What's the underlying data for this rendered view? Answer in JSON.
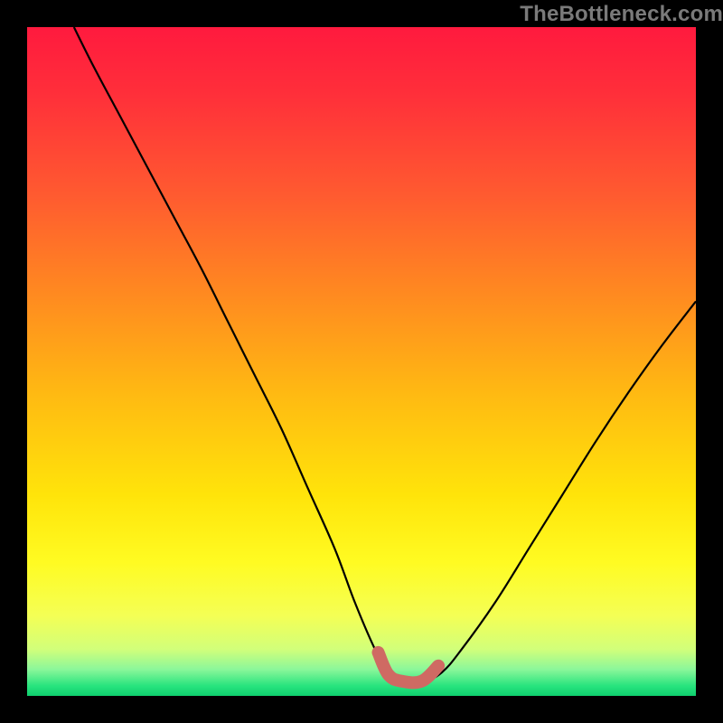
{
  "watermark": "TheBottleneck.com",
  "colors": {
    "frame_background": "#000000",
    "curve_stroke": "#000000",
    "optimal_stroke": "#cf6a63"
  },
  "chart_data": {
    "type": "line",
    "title": "",
    "xlabel": "",
    "ylabel": "",
    "xlim": [
      0,
      100
    ],
    "ylim": [
      0,
      100
    ],
    "grid": false,
    "background_gradient_stops": [
      {
        "offset": 0.0,
        "color": "#ff1a3e"
      },
      {
        "offset": 0.1,
        "color": "#ff2f3a"
      },
      {
        "offset": 0.25,
        "color": "#ff5a30"
      },
      {
        "offset": 0.4,
        "color": "#ff8a20"
      },
      {
        "offset": 0.55,
        "color": "#ffba12"
      },
      {
        "offset": 0.7,
        "color": "#ffe40a"
      },
      {
        "offset": 0.8,
        "color": "#fffb22"
      },
      {
        "offset": 0.88,
        "color": "#f4ff55"
      },
      {
        "offset": 0.93,
        "color": "#d2ff7a"
      },
      {
        "offset": 0.96,
        "color": "#8cf79a"
      },
      {
        "offset": 0.985,
        "color": "#28e47e"
      },
      {
        "offset": 1.0,
        "color": "#0fcf6e"
      }
    ],
    "series": [
      {
        "name": "bottleneck-curve",
        "x": [
          7,
          10,
          14,
          18,
          22,
          26,
          30,
          34,
          38,
          42,
          46,
          49,
          52,
          54,
          56,
          59,
          62,
          65,
          70,
          75,
          80,
          85,
          90,
          95,
          100
        ],
        "y": [
          100,
          94,
          86.5,
          79,
          71.5,
          64,
          56,
          48,
          40,
          31,
          22,
          14,
          7,
          3.5,
          2,
          2,
          3.5,
          7,
          14,
          22,
          30,
          38,
          45.5,
          52.5,
          59
        ]
      }
    ],
    "optimal_range": {
      "description": "x range where bottleneck is near zero",
      "points_x": [
        52.5,
        54,
        56,
        59,
        61.5
      ],
      "points_y": [
        6.5,
        3.2,
        2.2,
        2.2,
        4.5
      ]
    }
  }
}
